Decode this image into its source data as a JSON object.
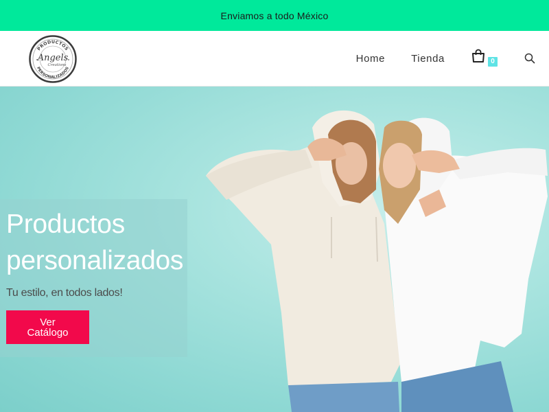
{
  "topbar": {
    "announcement": "Enviamos a todo México"
  },
  "header": {
    "logo": {
      "top_text": "PRODUCTOS",
      "script_text": "Angels",
      "sub_text": "Creations",
      "bottom_text": "PERSONALIZADOS"
    },
    "nav": [
      {
        "label": "Home"
      },
      {
        "label": "Tienda"
      }
    ],
    "cart": {
      "icon": "shopping-bag-icon",
      "count": "0"
    },
    "search": {
      "icon": "search-icon"
    }
  },
  "hero": {
    "title": "Productos personalizados",
    "subtitle": "Tu estilo, en todos lados!",
    "button_line1": "Ver",
    "button_line2": "Catálogo",
    "image_subject": "two-young-women-in-hoodies-photo"
  },
  "colors": {
    "topbar_bg": "#00e99b",
    "hero_bg": "#a9e4df",
    "button_bg": "#f2094b",
    "cart_badge": "#5fe3e5"
  }
}
